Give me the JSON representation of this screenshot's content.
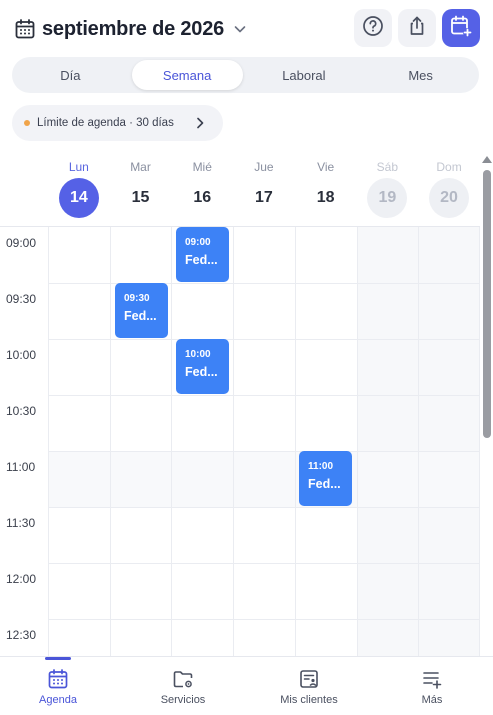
{
  "header": {
    "title": "septiembre de 2026",
    "icons": [
      "calendar-icon",
      "chevron-down-icon",
      "help-icon",
      "share-icon",
      "add-event-icon"
    ]
  },
  "view_tabs": [
    {
      "label": "Día",
      "active": false
    },
    {
      "label": "Semana",
      "active": true
    },
    {
      "label": "Laboral",
      "active": false
    },
    {
      "label": "Mes",
      "active": false
    }
  ],
  "limit_chip": {
    "label": "Límite de agenda · 30 días"
  },
  "days": [
    {
      "name": "Lun",
      "number": "14",
      "state": "today"
    },
    {
      "name": "Mar",
      "number": "15",
      "state": "normal"
    },
    {
      "name": "Mié",
      "number": "16",
      "state": "normal"
    },
    {
      "name": "Jue",
      "number": "17",
      "state": "normal"
    },
    {
      "name": "Vie",
      "number": "18",
      "state": "normal"
    },
    {
      "name": "Sáb",
      "number": "19",
      "state": "off"
    },
    {
      "name": "Dom",
      "number": "20",
      "state": "off"
    }
  ],
  "time_slots": [
    "09:00",
    "09:30",
    "10:00",
    "10:30",
    "11:00",
    "11:30",
    "12:00",
    "12:30"
  ],
  "events": [
    {
      "time": "09:00",
      "title": "Fed...",
      "day": "Mié"
    },
    {
      "time": "09:30",
      "title": "Fed...",
      "day": "Mar"
    },
    {
      "time": "10:00",
      "title": "Fed...",
      "day": "Mié"
    },
    {
      "time": "11:00",
      "title": "Fed...",
      "day": "Vie"
    }
  ],
  "bottom_nav": [
    {
      "label": "Agenda",
      "icon": "calendar-icon",
      "active": true
    },
    {
      "label": "Servicios",
      "icon": "folder-settings-icon",
      "active": false
    },
    {
      "label": "Mis clientes",
      "icon": "client-card-icon",
      "active": false
    },
    {
      "label": "Más",
      "icon": "more-list-icon",
      "active": false
    }
  ],
  "colors": {
    "accent": "#5561e6",
    "event": "#3d82f6",
    "limit_dot": "#f0a44a"
  }
}
